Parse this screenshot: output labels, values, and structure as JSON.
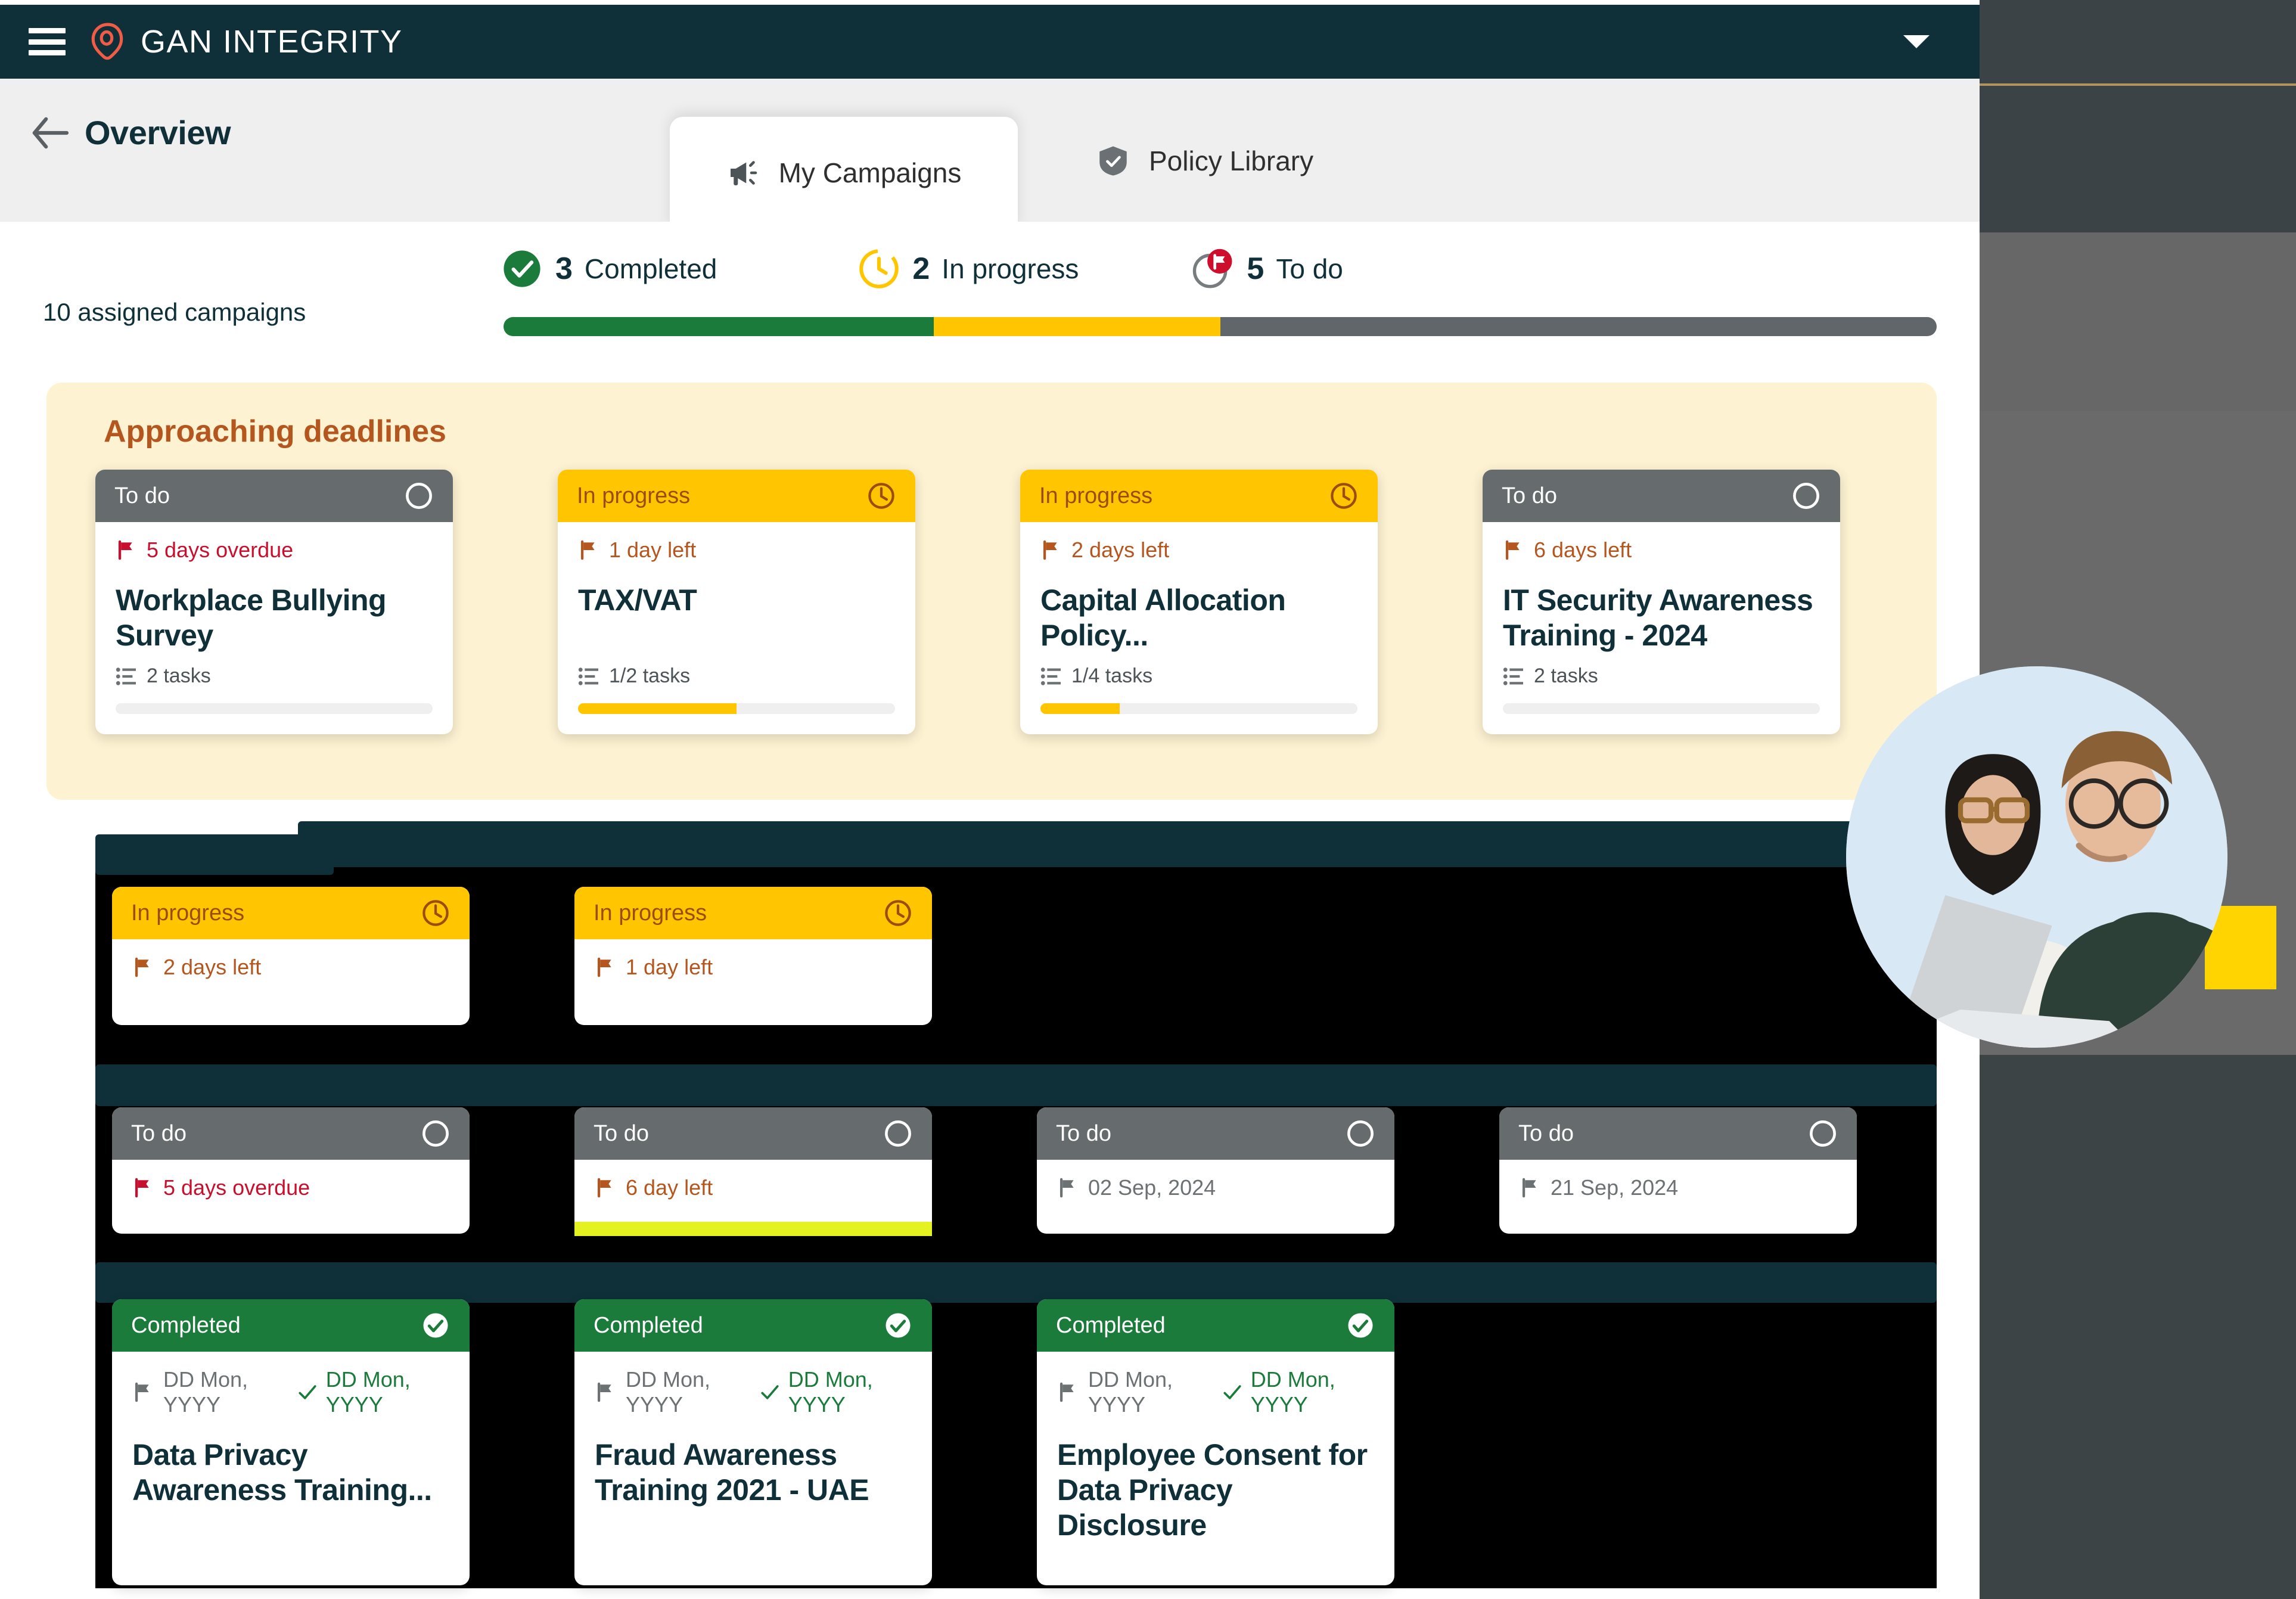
{
  "navbar": {
    "brand_name": "GAN INTEGRITY",
    "menu_icon": "hamburger-icon",
    "caret_icon": "chevron-down-icon"
  },
  "header": {
    "back_icon": "back-arrow-icon",
    "title": "Overview"
  },
  "tabs": [
    {
      "label": "My Campaigns",
      "icon": "megaphone-icon",
      "active": true
    },
    {
      "label": "Policy Library",
      "icon": "shield-check-icon",
      "active": false
    }
  ],
  "summary": {
    "assigned_label": "10 assigned campaigns",
    "stats": [
      {
        "count": "3",
        "label": "Completed",
        "icon": "check-circle-icon",
        "color": "#1b7b3b"
      },
      {
        "count": "2",
        "label": "In progress",
        "icon": "clock-circle-icon",
        "color": "#ffc600"
      },
      {
        "count": "5",
        "label": "To do",
        "icon": "flag-circle-icon",
        "color": "#606669"
      }
    ],
    "progress": {
      "completed_pct": 30,
      "in_progress_pct": 20,
      "todo_pct": 50
    }
  },
  "deadlines": {
    "title": "Approaching deadlines",
    "cards": [
      {
        "status": "To do",
        "status_kind": "todo",
        "head_icon": "circle-outline-icon",
        "due": "5 days overdue",
        "due_kind": "overdue",
        "title": "Workplace Bullying Survey",
        "tasks": "2 tasks",
        "progress_pct": 0
      },
      {
        "status": "In progress",
        "status_kind": "progress",
        "head_icon": "clock-icon",
        "due": "1 day left",
        "due_kind": "left",
        "title": "TAX/VAT",
        "tasks": "1/2 tasks",
        "progress_pct": 50
      },
      {
        "status": "In progress",
        "status_kind": "progress",
        "head_icon": "clock-icon",
        "due": "2 days left",
        "due_kind": "left",
        "title": "Capital Allocation Policy...",
        "tasks": "1/4 tasks",
        "progress_pct": 25
      },
      {
        "status": "To do",
        "status_kind": "todo",
        "head_icon": "circle-outline-icon",
        "due": "6 days left",
        "due_kind": "left",
        "title": "IT Security Awareness Training - 2024",
        "tasks": "2 tasks",
        "progress_pct": 0
      }
    ]
  },
  "sections": [
    {
      "kind": "progress",
      "cards": [
        {
          "status": "In progress",
          "status_kind": "progress",
          "head_icon": "clock-icon",
          "due": "2 days left",
          "due_kind": "left"
        },
        {
          "status": "In progress",
          "status_kind": "progress",
          "head_icon": "clock-icon",
          "due": "1 day left",
          "due_kind": "left"
        }
      ]
    },
    {
      "kind": "todo",
      "cards": [
        {
          "status": "To do",
          "status_kind": "todo",
          "head_icon": "circle-outline-icon",
          "due": "5 days overdue",
          "due_kind": "overdue"
        },
        {
          "status": "To do",
          "status_kind": "todo",
          "head_icon": "circle-outline-icon",
          "due": "6 day left",
          "due_kind": "left"
        },
        {
          "status": "To do",
          "status_kind": "todo",
          "head_icon": "circle-outline-icon",
          "due": "02 Sep, 2024",
          "due_kind": "plain"
        },
        {
          "status": "To do",
          "status_kind": "todo",
          "head_icon": "circle-outline-icon",
          "due": "21 Sep, 2024",
          "due_kind": "plain"
        }
      ]
    },
    {
      "kind": "completed",
      "cards": [
        {
          "status": "Completed",
          "status_kind": "completed",
          "head_icon": "check-badge-icon",
          "due": "DD Mon, YYYY",
          "due_kind": "plain",
          "done": "DD Mon, YYYY",
          "title": "Data Privacy Awareness Training..."
        },
        {
          "status": "Completed",
          "status_kind": "completed",
          "head_icon": "check-badge-icon",
          "due": "DD Mon, YYYY",
          "due_kind": "plain",
          "done": "DD Mon, YYYY",
          "title": "Fraud Awareness Training 2021 - UAE"
        },
        {
          "status": "Completed",
          "status_kind": "completed",
          "head_icon": "check-badge-icon",
          "due": "DD Mon, YYYY",
          "due_kind": "plain",
          "done": "DD Mon, YYYY",
          "title": "Employee Consent for Data Privacy Disclosure"
        }
      ]
    }
  ],
  "decor": {
    "photo_alt": "two-colleagues-with-laptop-photo"
  },
  "colors": {
    "brand_dark": "#0f3039",
    "brand_accent": "#f05c46",
    "status_green": "#1b7b3b",
    "status_yellow": "#ffc600",
    "status_grey": "#666b6e",
    "overdue_red": "#c8102e",
    "deadline_orange": "#b4561e",
    "deadline_panel": "#fdf2d2"
  }
}
